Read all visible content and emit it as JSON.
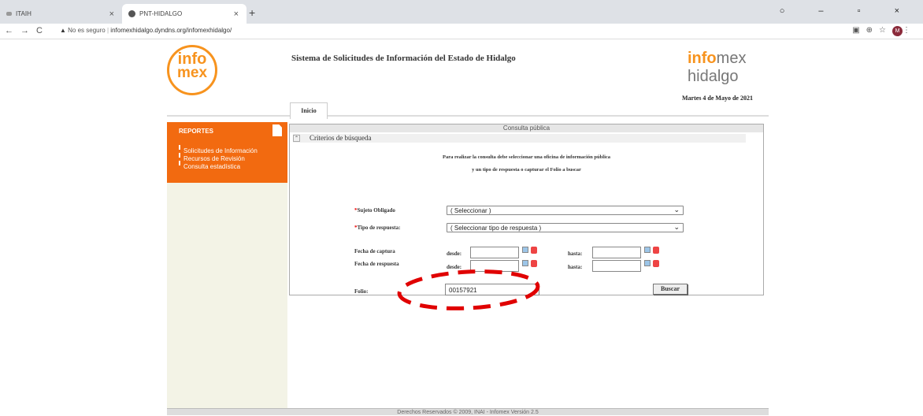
{
  "browser": {
    "tabs": [
      {
        "title": "ITAIH",
        "close": "×"
      },
      {
        "title": "PNT-HIDALGO",
        "close": "×"
      }
    ],
    "new_tab": "+",
    "window_controls": "○ – ▫ ×",
    "security_label": "No es seguro",
    "url": "infomexhidalgo.dyndns.org/infomexhidalgo/",
    "avatar": "M"
  },
  "header": {
    "logo_left_line1": "info",
    "logo_left_line2": "mex",
    "system_title": "Sistema de Solicitudes de Información del Estado de Hidalgo",
    "logo_right_info": "info",
    "logo_right_mex": "mex",
    "logo_right_hidalgo": "hidalgo",
    "date": "Martes 4 de Mayo de 2021",
    "tab_inicio": "Inicio"
  },
  "sidebar": {
    "title": "REPORTES",
    "links": [
      "Solicitudes de Información",
      "Recursos de Revisión",
      "Consulta estadística"
    ]
  },
  "panel": {
    "header": "Consulta pública",
    "criteria": "Criterios de búsqueda",
    "instruction_line1": "Para realizar la consulta debe seleccionar una oficina de información pública",
    "instruction_line2": "y un tipo de respuesta o capturar el Folio a buscar",
    "required_mark": "*",
    "sujeto_label": "Sujeto Obligado",
    "sujeto_value": "( Seleccionar )",
    "tipo_label": "Tipo de respuesta:",
    "tipo_value": "( Seleccionar tipo de respuesta )",
    "fecha_captura_label": "Fecha de captura",
    "fecha_respuesta_label": "Fecha de respuesta",
    "desde_label": "desde:",
    "hasta_label": "hasta:",
    "folio_label": "Folio:",
    "folio_value": "00157921",
    "buscar_label": "Buscar"
  },
  "footer": {
    "text": "Derechos Reservados © 2009, INAI - Infomex Versión 2.5"
  },
  "colors": {
    "accent": "#f26a10",
    "logo": "#f7931e",
    "annotation": "#e00000"
  }
}
